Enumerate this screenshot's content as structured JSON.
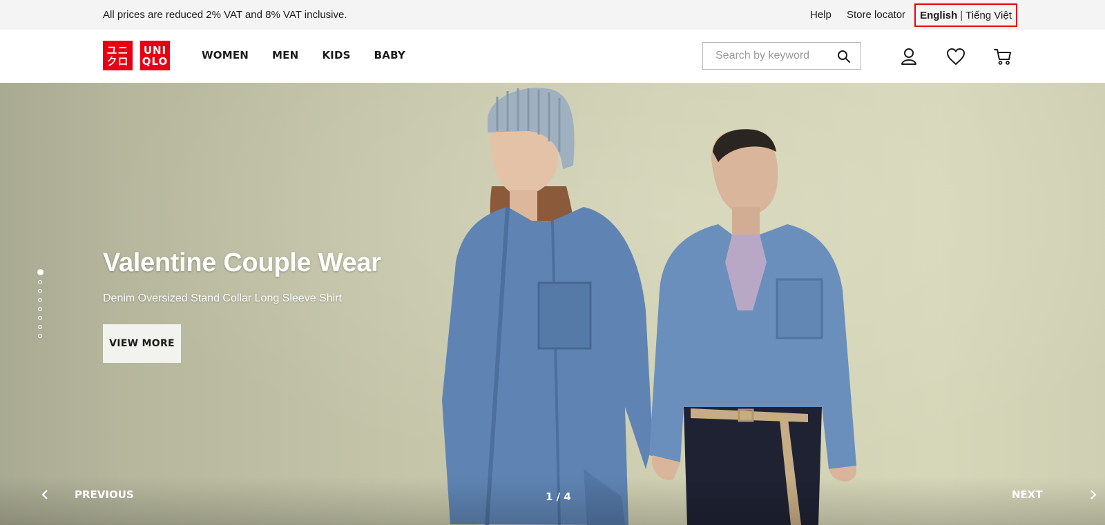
{
  "topbar": {
    "notice": "All prices are reduced 2% VAT and 8% VAT inclusive.",
    "help": "Help",
    "store_locator": "Store locator",
    "lang_english": "English",
    "lang_sep": "|",
    "lang_vietnamese": "Tiếng Việt"
  },
  "header": {
    "logo": {
      "block1_line1": "ユニ",
      "block1_line2": "クロ",
      "block2_line1": "UNI",
      "block2_line2": "QLO"
    },
    "nav": [
      "WOMEN",
      "MEN",
      "KIDS",
      "BABY"
    ],
    "search": {
      "placeholder": "Search by keyword",
      "value": ""
    },
    "icons": [
      "account-icon",
      "wishlist-heart-icon",
      "cart-icon"
    ]
  },
  "hero": {
    "title": "Valentine Couple Wear",
    "subtitle": "Denim Oversized Stand Collar Long Sleeve Shirt",
    "cta": "VIEW MORE",
    "previous": "PREVIOUS",
    "next": "NEXT",
    "counter": "1 / 4",
    "slide_dots": 8,
    "active_dot": 1
  },
  "colors": {
    "brand_red": "#e60012",
    "topbar_bg": "#f4f4f4",
    "hero_bg": "#c9caae",
    "denim": "#5f84b3"
  }
}
